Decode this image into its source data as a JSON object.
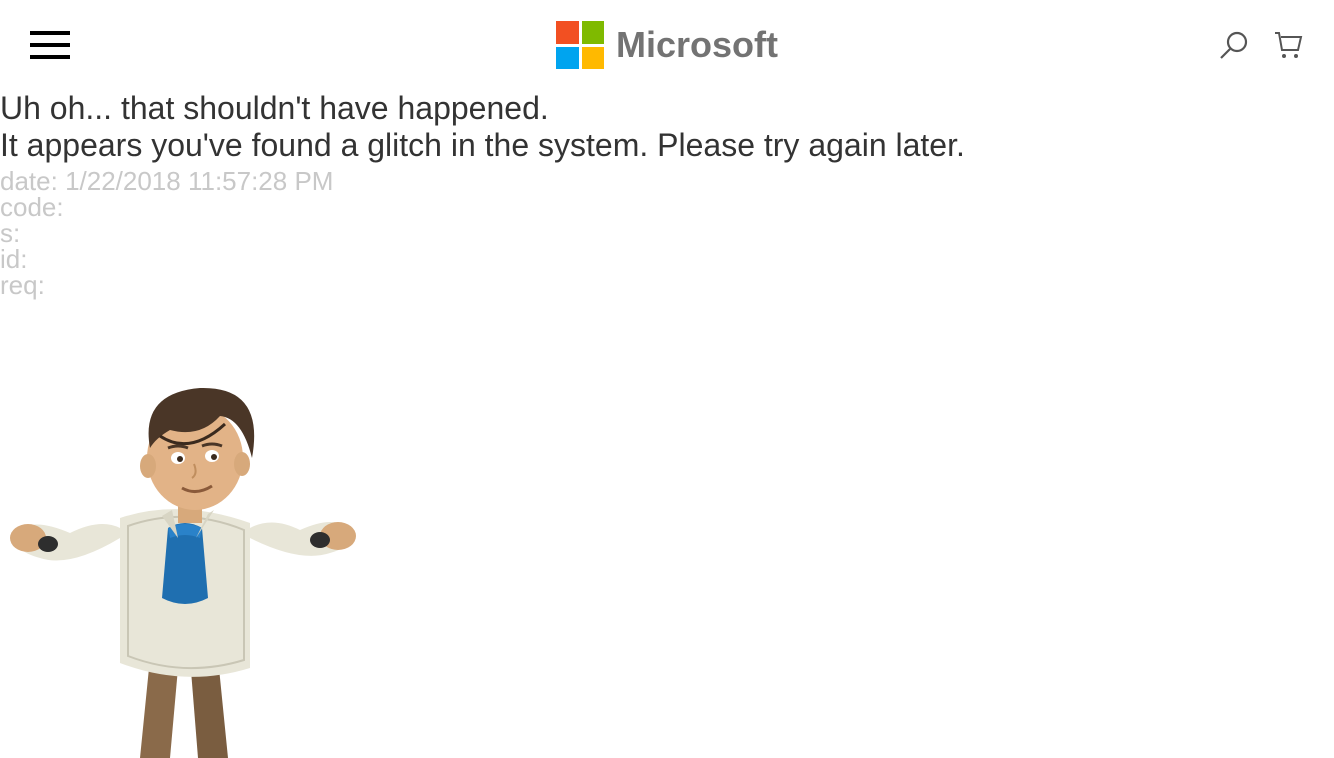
{
  "header": {
    "brand": "Microsoft",
    "colors": {
      "tile_red": "#f25022",
      "tile_green": "#7fba00",
      "tile_blue": "#00a4ef",
      "tile_yellow": "#ffb900"
    },
    "icons": {
      "menu": "hamburger-icon",
      "search": "search-icon",
      "cart": "cart-icon"
    }
  },
  "error": {
    "title": "Uh oh... that shouldn't have happened.",
    "message": "It appears you've found a glitch in the system. Please try again later.",
    "meta": {
      "date_label": "date:",
      "date_value": "1/22/2018 11:57:28 PM",
      "code_label": "code:",
      "code_value": "",
      "s_label": "s:",
      "s_value": "",
      "id_label": "id:",
      "id_value": "",
      "req_label": "req:",
      "req_value": ""
    }
  },
  "illustration": {
    "name": "shrugging-avatar"
  }
}
